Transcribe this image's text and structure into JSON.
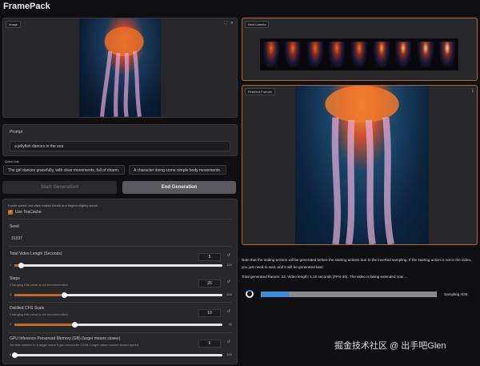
{
  "app": {
    "title": "FramePack"
  },
  "image_panel": {
    "label": "Image",
    "fullscreen_icon": "⛶",
    "close_icon": "✕"
  },
  "prompt": {
    "label": "Prompt",
    "value": "a jellyfish dances in the sea"
  },
  "quick_list": {
    "label": "Quick List",
    "items": [
      "The girl dances gracefully, with clear movements, full of charm.",
      "A character doing some simple body movements."
    ]
  },
  "buttons": {
    "start": "Start Generation",
    "end": "End Generation"
  },
  "settings": {
    "teacache_note": "Faster speed, but often makes hands and fingers slightly worse.",
    "teacache_label": "Use TeaCache",
    "teacache_checked": true,
    "seed_label": "Seed",
    "seed_value": "31337",
    "sliders": [
      {
        "label": "Total Video Length (Seconds)",
        "desc": "",
        "value": "5",
        "min": "1",
        "max": "120",
        "fraction": 0.03
      },
      {
        "label": "Steps",
        "desc": "Changing this value is not recommended.",
        "value": "25",
        "min": "1",
        "max": "100",
        "fraction": 0.24
      },
      {
        "label": "Distilled CFG Scale",
        "desc": "Changing this value is not recommended.",
        "value": "10",
        "min": "1",
        "max": "32",
        "fraction": 0.29
      },
      {
        "label": "GPU Inference Preserved Memory (GB) (larger means slower)",
        "desc": "Set this number to a larger value if you encounter OOM. Larger value causes slower speed.",
        "value": "6",
        "min": "6",
        "max": "128",
        "fraction": 0.0
      }
    ],
    "reset_icon": "↺"
  },
  "latents_panel": {
    "label": "Next Latents"
  },
  "frames_panel": {
    "label": "Finished Frames",
    "download_icon": "⤓"
  },
  "status": {
    "note": "Note that the ending actions will be generated before the starting actions due to the inverted sampling. If the starting action is not in the video, you just need to wait, and it will be generated later.",
    "progress_text": "Total generated frames: 33, Video length: 1.10 seconds (FPS-30). The video is being extended now ...",
    "progress_label": "Sampling 4/25",
    "progress_fraction": 0.16,
    "accent": "#c0672c",
    "progress_color": "#3a8fd8"
  },
  "watermark": "掘金技术社区 @ 出手吧Glen"
}
